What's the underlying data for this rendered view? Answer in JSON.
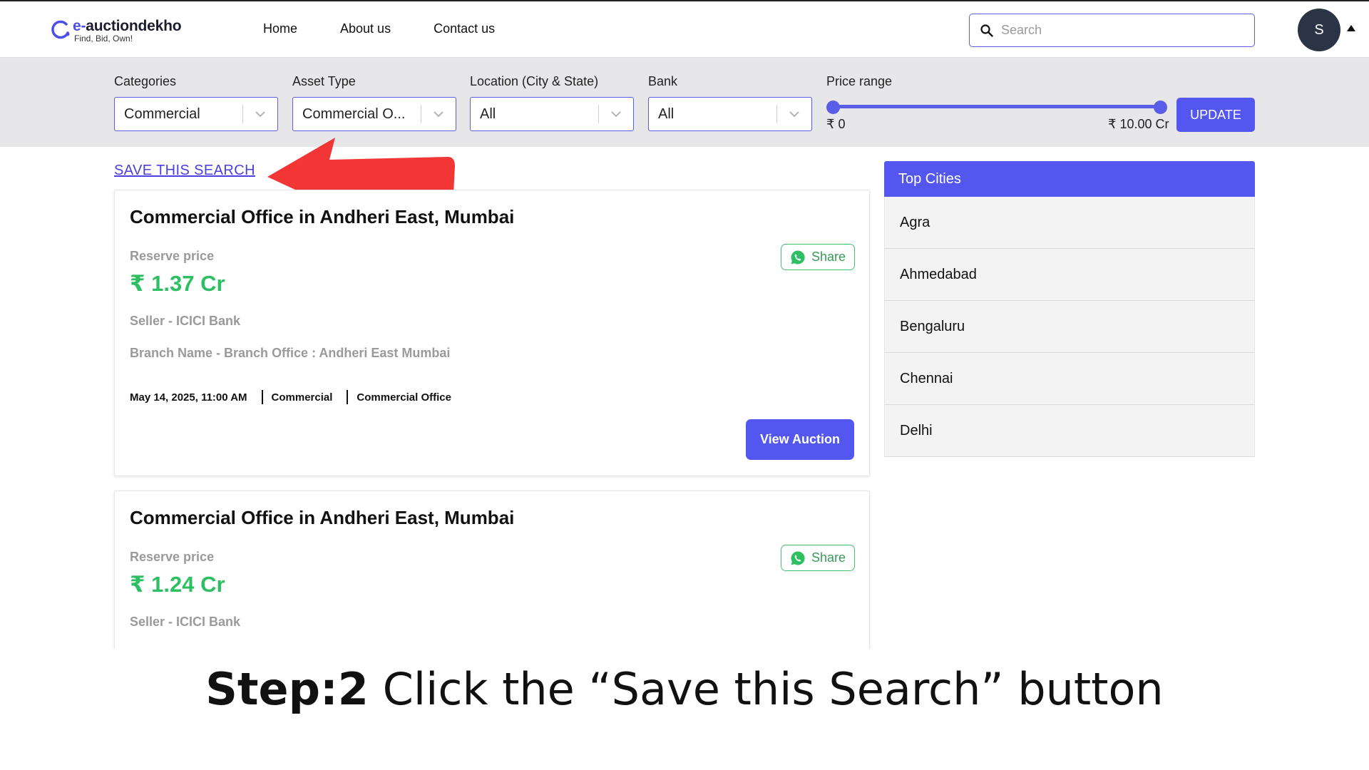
{
  "header": {
    "logo_name_accent": "e-",
    "logo_name_rest": "auctiondekho",
    "logo_tagline": "Find, Bid, Own!",
    "nav": [
      "Home",
      "About us",
      "Contact us"
    ],
    "search_placeholder": "Search",
    "avatar_initial": "S"
  },
  "filters": {
    "categories": {
      "label": "Categories",
      "value": "Commercial"
    },
    "asset_type": {
      "label": "Asset Type",
      "value": "Commercial O..."
    },
    "location": {
      "label": "Location (City & State)",
      "value": "All"
    },
    "bank": {
      "label": "Bank",
      "value": "All"
    },
    "price_range": {
      "label": "Price range",
      "min": "₹ 0",
      "max": "₹ 10.00 Cr"
    },
    "update_label": "UPDATE"
  },
  "save_search_label": "SAVE THIS SEARCH",
  "listings": [
    {
      "title": "Commercial Office in Andheri East, Mumbai",
      "reserve_label": "Reserve price",
      "price": "₹ 1.37 Cr",
      "share_label": "Share",
      "seller": "Seller -  ICICI Bank",
      "branch": "Branch Name -  Branch Office : Andheri East Mumbai",
      "date": "May 14, 2025, 11:00 AM",
      "category": "Commercial",
      "asset": "Commercial Office",
      "view_label": "View Auction"
    },
    {
      "title": "Commercial Office in Andheri East, Mumbai",
      "reserve_label": "Reserve price",
      "price": "₹ 1.24 Cr",
      "share_label": "Share",
      "seller": "Seller -  ICICI Bank"
    }
  ],
  "top_cities": {
    "title": "Top Cities",
    "items": [
      "Agra",
      "Ahmedabad",
      "Bengaluru",
      "Chennai",
      "Delhi"
    ]
  },
  "caption": {
    "bold": "Step:2",
    "rest": " Click the “Save this Search” button"
  },
  "colors": {
    "accent": "#5457ef",
    "price_green": "#2fbf63",
    "annotation_arrow": "#f23636"
  }
}
